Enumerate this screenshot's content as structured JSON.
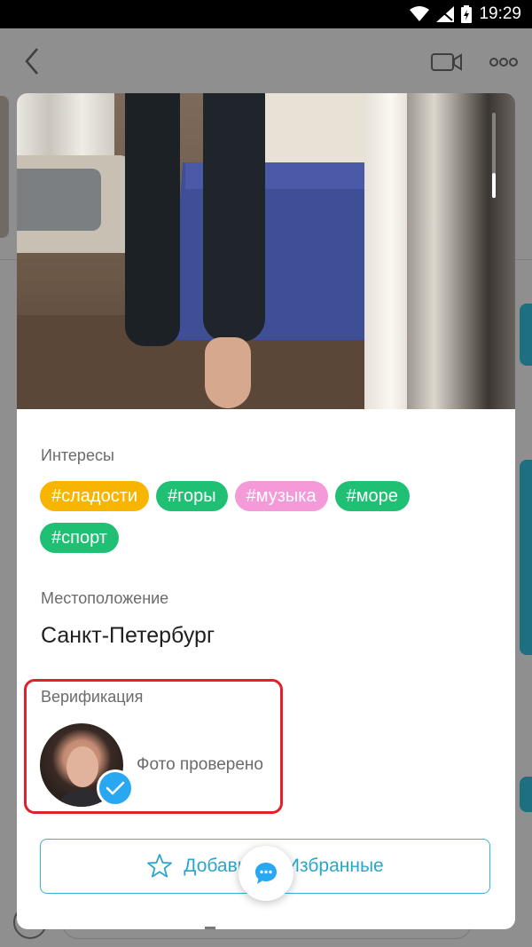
{
  "status_bar": {
    "time": "19:29"
  },
  "profile": {
    "interests_label": "Интересы",
    "tags": [
      {
        "text": "#сладости",
        "color": "#f7b500"
      },
      {
        "text": "#горы",
        "color": "#1fbf74"
      },
      {
        "text": "#музыка",
        "color": "#f49ad9"
      },
      {
        "text": "#море",
        "color": "#1fbf74"
      },
      {
        "text": "#спорт",
        "color": "#1fbf74"
      }
    ],
    "location_label": "Местоположение",
    "location_value": "Санкт-Петербург",
    "verification_label": "Верификация",
    "verification_status": "Фото проверено",
    "favorites_button": "Добавить в Избранные"
  },
  "icons": {
    "back": "chevron-left-icon",
    "video": "video-camera-icon",
    "more": "more-dots-icon",
    "star": "star-icon",
    "chat": "chat-bubble-icon",
    "check": "checkmark-icon"
  },
  "colors": {
    "accent": "#29a8f1",
    "highlight_box": "#e0202a",
    "button_text": "#2aa6cc"
  }
}
